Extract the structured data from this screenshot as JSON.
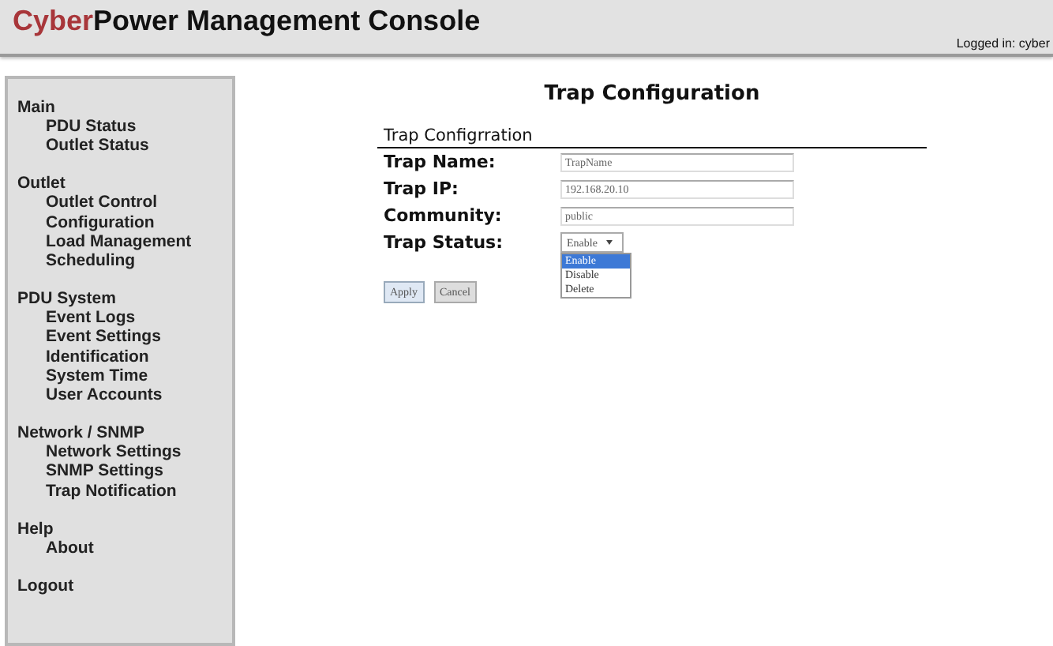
{
  "header": {
    "brand_highlight": "Cyber",
    "brand_rest": "Power Management Console",
    "login": "Logged in: cyber"
  },
  "sidebar": {
    "groups": [
      {
        "label": "Main",
        "items": [
          {
            "label": "PDU Status",
            "selected": false
          },
          {
            "label": "Outlet Status",
            "selected": false
          }
        ]
      },
      {
        "label": "Outlet",
        "items": [
          {
            "label": "Outlet Control",
            "selected": false
          },
          {
            "label": "Configuration",
            "selected": false
          },
          {
            "label": "Load Management",
            "selected": false
          },
          {
            "label": "Scheduling",
            "selected": false
          }
        ]
      },
      {
        "label": "PDU System",
        "items": [
          {
            "label": "Event Logs",
            "selected": false
          },
          {
            "label": "Event Settings",
            "selected": false
          },
          {
            "label": "Identification",
            "selected": false
          },
          {
            "label": "System Time",
            "selected": false
          },
          {
            "label": "User Accounts",
            "selected": false
          }
        ]
      },
      {
        "label": "Network / SNMP",
        "items": [
          {
            "label": "Network Settings",
            "selected": false
          },
          {
            "label": "SNMP Settings",
            "selected": false
          },
          {
            "label": "Trap Notification",
            "selected": false
          }
        ]
      },
      {
        "label": "Help",
        "items": [
          {
            "label": "About",
            "selected": false
          }
        ]
      },
      {
        "label": "Logout"
      }
    ]
  },
  "page": {
    "title": "Trap Configuration",
    "section": "Trap Configrration",
    "fields": [
      {
        "kind": "text",
        "label": "Trap Name:",
        "value": "TrapName"
      },
      {
        "kind": "text",
        "label": "Trap IP:",
        "value": "192.168.20.10"
      },
      {
        "kind": "text",
        "label": "Community:",
        "value": "public"
      },
      {
        "kind": "select",
        "label": "Trap Status:",
        "value": "Enable",
        "expanded": true,
        "options": [
          {
            "label": "Enable",
            "selected": true
          },
          {
            "label": "Disable",
            "selected": false
          },
          {
            "label": "Delete",
            "selected": false
          }
        ]
      }
    ],
    "buttons": [
      {
        "label": "Apply",
        "kind": "primary"
      },
      {
        "label": "Cancel",
        "kind": "secondary"
      }
    ]
  }
}
